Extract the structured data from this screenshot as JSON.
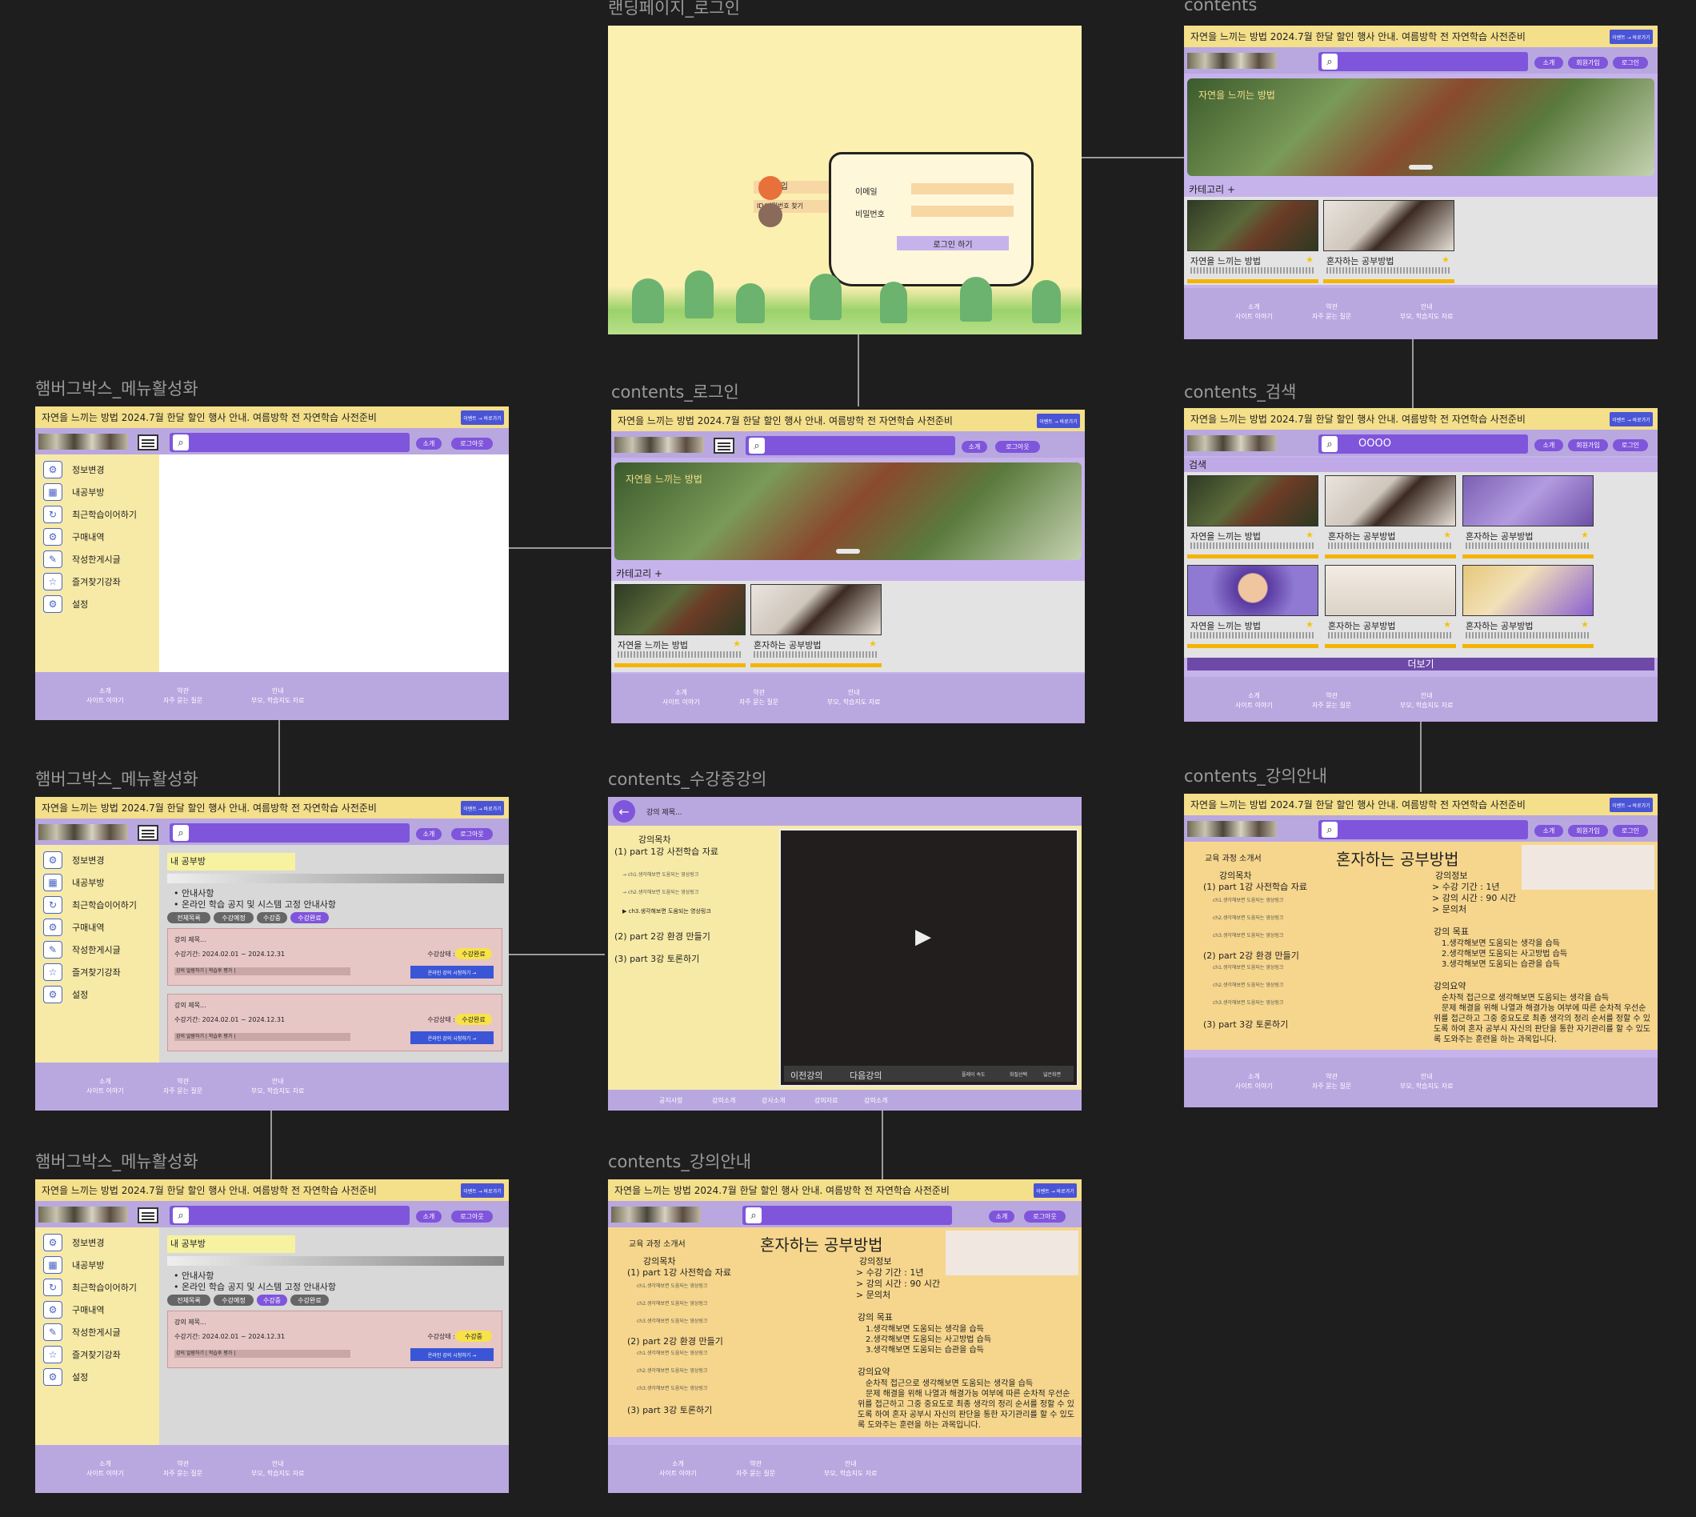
{
  "frames": {
    "landing": "랜딩페이지_로그인",
    "contents": "contents",
    "ham1": "햄버그박스_메뉴활성화",
    "contents_login": "contents_로그인",
    "contents_search": "contents_검색",
    "ham2": "햄버그박스_메뉴활성화",
    "contents_watching": "contents_수강중강의",
    "contents_info1": "contents_강의안내",
    "ham3": "햄버그박스_메뉴활성화",
    "contents_info2": "contents_강의안내"
  },
  "topbar": {
    "text": "자연을 느끼는 방법 2024.7월 한달 할인 행사 안내. 여름방학 전 자연학습 사전준비",
    "button": "이벤트 → 바로가기"
  },
  "nav": {
    "intro": "소개",
    "signup": "회원가입",
    "login": "로그인",
    "logout": "로그아웃",
    "search_query": "OOOO"
  },
  "login": {
    "signup": "회원가입",
    "find": "ID/비밀번호 찾기",
    "email_label": "이메일",
    "password_label": "비밀번호",
    "submit": "로그인 하기"
  },
  "hero": {
    "title": "자연을 느끼는 방법"
  },
  "category": "카테고리 +",
  "search_label": "검색",
  "more": "더보기",
  "cards": {
    "nature": "자연을 느끼는 방법",
    "study": "혼자하는 공부방법"
  },
  "footer": {
    "c1": "소개",
    "c1b": "사이트 이야기",
    "c2": "약관",
    "c2b": "자주 묻는 질문",
    "c3": "안내",
    "c3b": "부모, 학습지도 자료"
  },
  "sidebar": {
    "items": [
      "정보변경",
      "내공부방",
      "최근학습이어하기",
      "구매내역",
      "작성한게시글",
      "즐겨찾기강좌",
      "설정"
    ]
  },
  "mypage": {
    "title": "내 공부방",
    "notice1": "• 안내사항",
    "notice2": "• 온라인 학습 공지 및 시스템 고정 안내사항",
    "chips": [
      "전체목록",
      "수강예정",
      "수강중",
      "수강완료"
    ],
    "lec_title": "강의 제목...",
    "lec_period": "수강기간: 2024.02.01 ~ 2024.12.31",
    "lec_status": "수강상태 :",
    "badge_done": "수강완료",
    "badge_ing": "수강중",
    "lec_progress": "강의 알람하기 | 학습후 평가 |",
    "lec_button": "온라인 강의 시청하기 →"
  },
  "player": {
    "title": "강의 제목...",
    "toc": "강의목차",
    "part1": "(1) part 1강 사전학습 자료",
    "ch1": "→ ch1.생각해보면 도움되는 영상링크",
    "ch2": "→ ch2.생각해보면 도움되는 영상링크",
    "ch3": "ch3.생각해보면 도움되는 영상링크",
    "part2": "(2) part 2강 환경 만들기",
    "part3": "(3) part 3강 토론하기",
    "prev": "이전강의",
    "next": "다음강의",
    "speed": "플레이 속도",
    "quality": "화질선택",
    "full": "넓은화면",
    "tabs": [
      "공지사항",
      "강의소개",
      "강사소개",
      "강의자료",
      "강의소개"
    ]
  },
  "course": {
    "doc_label": "교육 과정 소개서",
    "title": "혼자하는 공부방법",
    "toc": "강의목차",
    "part1": "(1) part 1강 사전학습 자료",
    "ch1": "ch1.생각해보면 도움되는 영상링크",
    "ch2": "ch2.생각해보면 도움되는 영상링크",
    "ch3": "ch3.생각해보면 도움되는 영상링크",
    "part2": "(2) part 2강 환경 만들기",
    "part3": "(3) part 3강 토론하기",
    "info_head": "강의정보",
    "info1": "> 수강 기간 : 1년",
    "info2": "> 강의 시간 : 90 시간",
    "info3": "> 문의처",
    "goal_head": "강의 목표",
    "goal1": "1.생각해보면 도움되는 생각을 습득",
    "goal2": "2.생각해보면 도움되는 사고방법 습득",
    "goal3": "3.생각해보면 도움되는 습관을 습득",
    "sum_head": "강의요약",
    "sum1": "순차적 접근으로 생각해보면 도움되는 생각을 습득",
    "sum2": "문제 해결을 위해 나열과 해결가능 여부에 따른 순차적 우선순",
    "sum3": "위를 접근하고 그중 중요도로 최종 생각의 정리 순서를 정할 수 있",
    "sum4": "도록 하여 혼자 공부시 자신의 판단을 통한 자기관리를 할 수 있도",
    "sum5": "록 도와주는 훈련을 하는 과목입니다."
  }
}
